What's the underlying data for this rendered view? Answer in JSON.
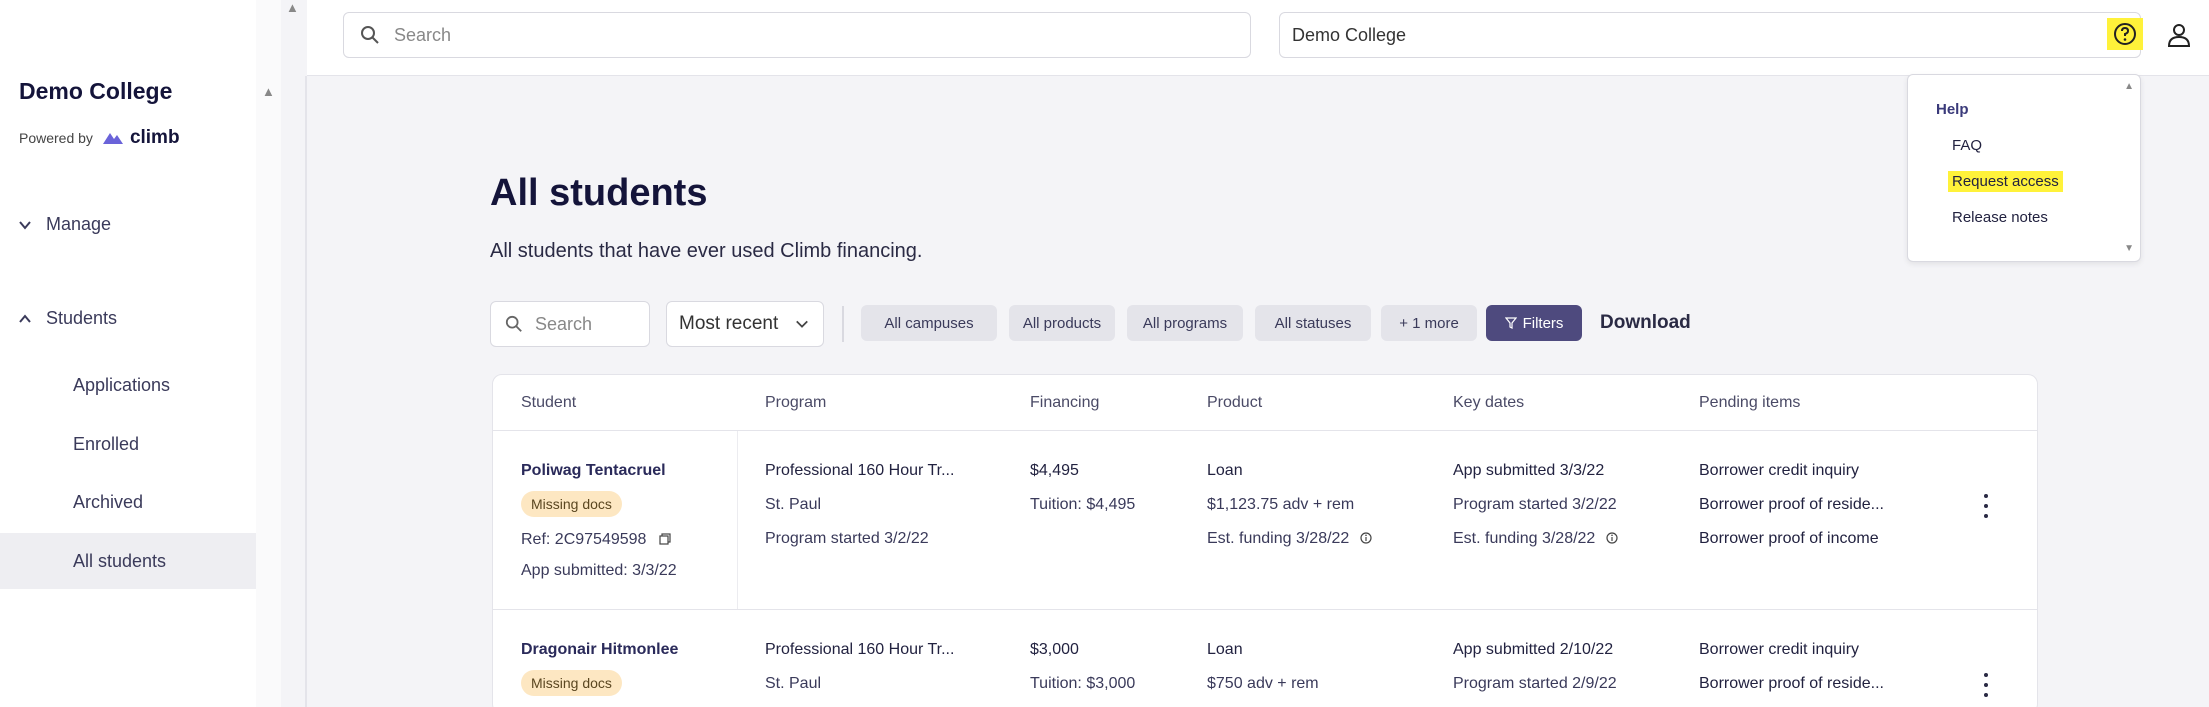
{
  "sidebar": {
    "brand": "Demo College",
    "powered_by": "Powered by",
    "climb_logo_text": "climb",
    "sections": [
      {
        "label": "Manage",
        "expanded": false
      },
      {
        "label": "Students",
        "expanded": true
      }
    ],
    "items": [
      {
        "label": "Applications",
        "active": false
      },
      {
        "label": "Enrolled",
        "active": false
      },
      {
        "label": "Archived",
        "active": false
      },
      {
        "label": "All students",
        "active": true
      }
    ]
  },
  "topbar": {
    "search_placeholder": "Search",
    "college_selected": "Demo College",
    "help_icon": "help-circle-icon",
    "user_icon": "user-icon",
    "highlight_color": "#fff23a"
  },
  "help_menu": {
    "title": "Help",
    "items": [
      "FAQ",
      "Request access",
      "Release notes"
    ],
    "highlighted": "Request access"
  },
  "main": {
    "title": "All students",
    "subtitle": "All students that have ever used Climb financing.",
    "search_placeholder": "Search",
    "sort_selected": "Most recent",
    "chips": [
      "All campuses",
      "All products",
      "All programs",
      "All statuses",
      "+ 1 more"
    ],
    "filters_label": "Filters",
    "download_label": "Download",
    "accent_color": "#4e4a7e"
  },
  "table": {
    "columns": [
      "Student",
      "Program",
      "Financing",
      "Product",
      "Key dates",
      "Pending items"
    ],
    "rows": [
      {
        "student": "Poliwag Tentacruel",
        "badge": "Missing docs",
        "ref": "Ref: 2C97549598",
        "app_submitted": "App submitted: 3/3/22",
        "program": "Professional 160 Hour Tr...",
        "campus": "St. Paul",
        "program_started": "Program started 3/2/22",
        "financing": "$4,495",
        "tuition": "Tuition: $4,495",
        "product": "Loan",
        "product_detail": "$1,123.75 adv + rem",
        "est_funding": "Est. funding 3/28/22",
        "key_dates": [
          "App submitted 3/3/22",
          "Program started 3/2/22",
          "Est. funding 3/28/22"
        ],
        "pending": [
          "Borrower credit inquiry",
          "Borrower proof of reside...",
          "Borrower proof of income"
        ]
      },
      {
        "student": "Dragonair Hitmonlee",
        "badge": "Missing docs",
        "program": "Professional 160 Hour Tr...",
        "campus": "St. Paul",
        "financing": "$3,000",
        "tuition": "Tuition: $3,000",
        "product": "Loan",
        "product_detail": "$750 adv + rem",
        "key_dates": [
          "App submitted 2/10/22",
          "Program started 2/9/22"
        ],
        "pending": [
          "Borrower credit inquiry",
          "Borrower proof of reside..."
        ]
      }
    ]
  }
}
